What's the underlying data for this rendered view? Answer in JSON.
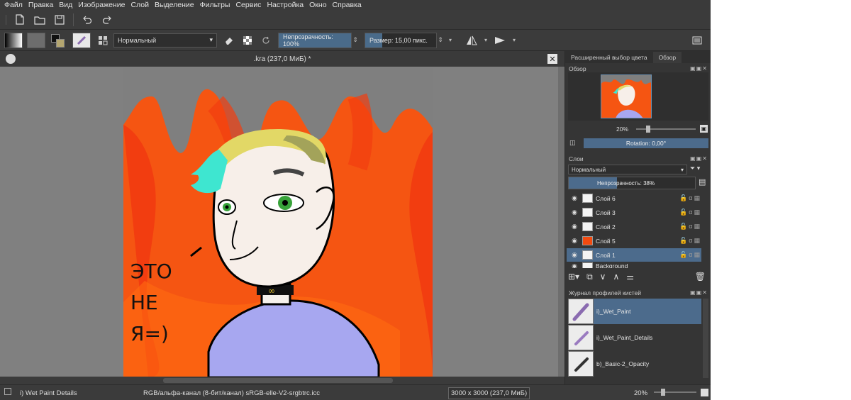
{
  "menu": {
    "items": [
      "Файл",
      "Правка",
      "Вид",
      "Изображение",
      "Слой",
      "Выделение",
      "Фильтры",
      "Сервис",
      "Настройка",
      "Окно",
      "Справка"
    ]
  },
  "toolbar": {
    "icons": [
      "new-document-icon",
      "open-folder-icon",
      "save-icon",
      "undo-icon",
      "redo-icon"
    ],
    "blend_mode": "Нормальный",
    "opacity_label": "Непрозрачность: 100%",
    "opacity_value": 100,
    "size_label": "Размер: 15,00 пикс.",
    "size_value": 15
  },
  "document": {
    "title": ".kra (237,0 МиБ) *",
    "close": "✕"
  },
  "painting_text": {
    "line1": "ЭТО",
    "line2": "НЕ",
    "line3": "Я=)"
  },
  "dock": {
    "tabs": [
      "Расширенный выбор цвета",
      "Обзор"
    ],
    "active_tab": "Обзор",
    "overview_title": "Обзор",
    "zoom": "20%",
    "rotation": "Rotation: 0,00°",
    "layers_title": "Слои",
    "layers_blend": "Нормальный",
    "layers_opacity": "Непрозрачность:  38%",
    "layers_opacity_value": 38,
    "layers": [
      {
        "name": "Слой 6",
        "selected": false
      },
      {
        "name": "Слой 3",
        "selected": false
      },
      {
        "name": "Слой 2",
        "selected": false
      },
      {
        "name": "Слой 5",
        "selected": false
      },
      {
        "name": "Слой 1",
        "selected": true
      },
      {
        "name": "Background",
        "selected": false
      }
    ],
    "brush_history_title": "Журнал профилей кистей",
    "brushes": [
      {
        "name": "i)_Wet_Paint",
        "selected": true
      },
      {
        "name": "i)_Wet_Paint_Details",
        "selected": false
      },
      {
        "name": "b)_Basic-2_Opacity",
        "selected": false
      }
    ]
  },
  "status": {
    "brush": "i) Wet Paint Details",
    "color_space": "RGB/альфа-канал (8-бит/канал)  sRGB-elle-V2-srgbtrc.icc",
    "dimensions": "3000 x 3000 (237,0 МиБ)",
    "zoom": "20%"
  }
}
